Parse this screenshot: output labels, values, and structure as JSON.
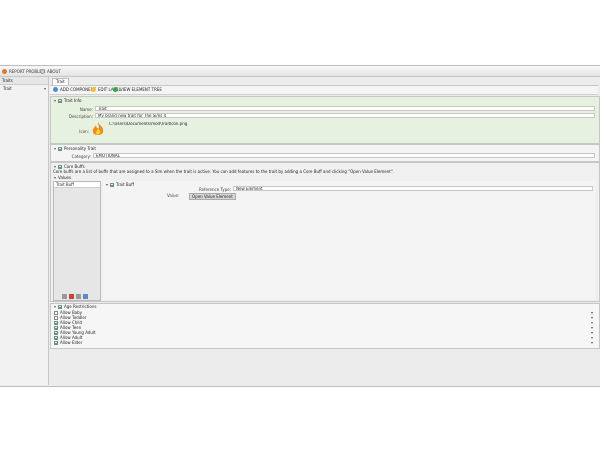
{
  "toolbar": {
    "report_problem": "REPORT PROBLEM",
    "about": "ABOUT"
  },
  "sidebar": {
    "header": "Traits",
    "items": [
      {
        "label": "Trait"
      }
    ]
  },
  "tabs": [
    {
      "label": "Trait"
    }
  ],
  "actions": {
    "add_component": "ADD COMPONENT",
    "edit_label": "EDIT LABEL",
    "view_element_tree": "VIEW ELEMENT TREE"
  },
  "trait_info": {
    "title": "Trait Info",
    "name_label": "Name:",
    "name_value": "Trait",
    "description_label": "Description:",
    "description_value": "My brand new trait for The Sims 4",
    "icon_label": "Icon:",
    "icon_path": "C:\\Users\\Documents\\mod\\TraitIcon.png"
  },
  "personality_trait": {
    "title": "Personality Trait",
    "category_label": "Category:",
    "category_value": "EMOTIONAL"
  },
  "core_buffs": {
    "title": "Core Buffs",
    "description": "Core buffs are a list of buffs that are assigned to a Sim when the trait is active. You can add features to the trait by adding a Core Buff and clicking \"Open Value Element\".",
    "values_label": "Values",
    "list_header": "Trait Buff",
    "buff_title": "Trait Buff",
    "values_sub": "Value:",
    "reference_type_label": "Reference Type:",
    "reference_type_value": "New Element",
    "open_value_element": "Open Value Element"
  },
  "age_restrictions": {
    "title": "Age Restrictions",
    "items": [
      {
        "label": "Allow Baby",
        "checked": false
      },
      {
        "label": "Allow Toddler",
        "checked": false
      },
      {
        "label": "Allow Child",
        "checked": true
      },
      {
        "label": "Allow Teen",
        "checked": true
      },
      {
        "label": "Allow Young Adult",
        "checked": true
      },
      {
        "label": "Allow Adult",
        "checked": true
      },
      {
        "label": "Allow Elder",
        "checked": true
      }
    ]
  }
}
